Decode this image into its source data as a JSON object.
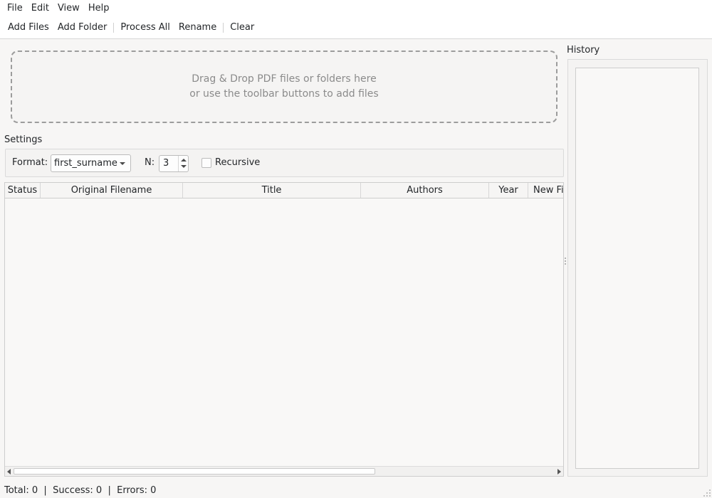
{
  "menubar": {
    "items": [
      "File",
      "Edit",
      "View",
      "Help"
    ]
  },
  "toolbar": {
    "add_files": "Add Files",
    "add_folder": "Add Folder",
    "process_all": "Process All",
    "rename": "Rename",
    "clear": "Clear"
  },
  "dropzone": {
    "line1": "Drag & Drop PDF files or folders here",
    "line2": "or use the toolbar buttons to add files"
  },
  "settings": {
    "title": "Settings",
    "format_label": "Format:",
    "format_value": "first_surname",
    "n_label": "N:",
    "n_value": "3",
    "recursive_label": "Recursive",
    "recursive_checked": false
  },
  "table": {
    "columns": [
      "Status",
      "Original Filename",
      "Title",
      "Authors",
      "Year",
      "New Fi"
    ],
    "rows": []
  },
  "history": {
    "title": "History",
    "items": []
  },
  "statusbar": {
    "total": "Total: 0",
    "success": "Success: 0",
    "errors": "Errors: 0",
    "separator": "|"
  }
}
